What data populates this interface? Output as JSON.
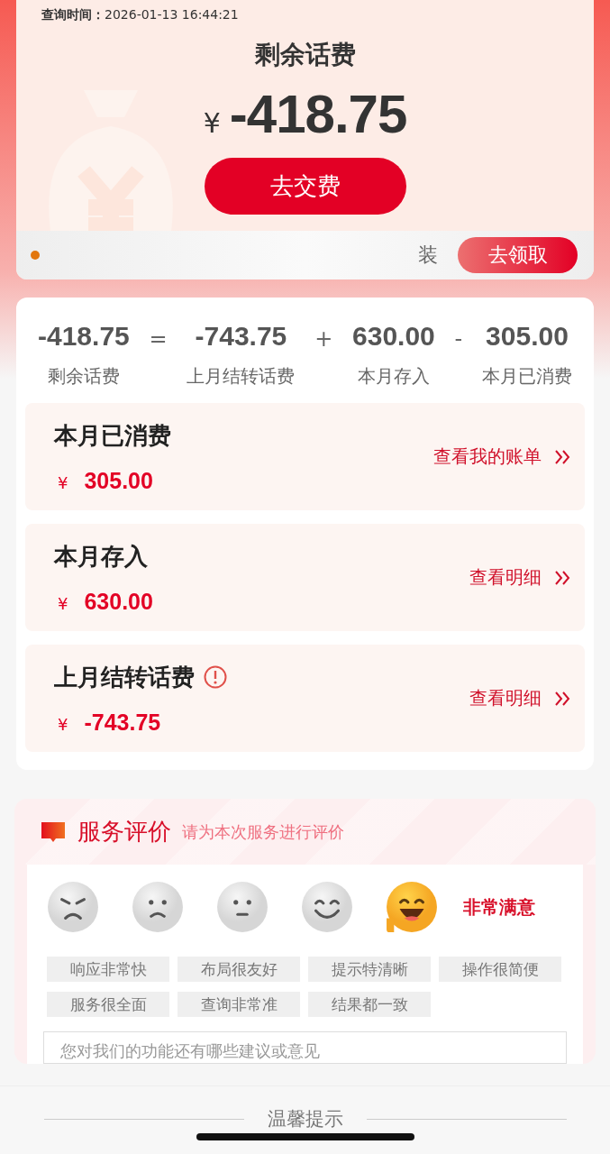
{
  "balance_card": {
    "query_label": "查询时间：",
    "query_time": "2026-01-13 16:44:21",
    "title": "剩余话费",
    "currency": "¥",
    "amount": "-418.75",
    "pay_button": "去交费"
  },
  "banner": {
    "text": "装",
    "button": "去领取"
  },
  "equation": [
    {
      "kind": "term",
      "value": "-418.75",
      "label": "剩余话费"
    },
    {
      "kind": "operator",
      "symbol": "="
    },
    {
      "kind": "term",
      "value": "-743.75",
      "label": "上月结转话费"
    },
    {
      "kind": "operator",
      "symbol": "+"
    },
    {
      "kind": "term",
      "value": "630.00",
      "label": "本月存入"
    },
    {
      "kind": "operator",
      "symbol": "-"
    },
    {
      "kind": "term",
      "value": "305.00",
      "label": "本月已消费"
    }
  ],
  "details": [
    {
      "title": "本月已消费",
      "info": false,
      "currency": "¥",
      "amount": "305.00",
      "link": "查看我的账单"
    },
    {
      "title": "本月存入",
      "info": false,
      "currency": "¥",
      "amount": "630.00",
      "link": "查看明细"
    },
    {
      "title": "上月结转话费",
      "info": true,
      "currency": "¥",
      "amount": "-743.75",
      "link": "查看明细"
    }
  ],
  "rating": {
    "title": "服务评价",
    "subtitle": "请为本次服务进行评价",
    "faces": [
      {
        "kind": "angry",
        "selected": false
      },
      {
        "kind": "sad",
        "selected": false
      },
      {
        "kind": "neutral",
        "selected": false
      },
      {
        "kind": "smile",
        "selected": false
      },
      {
        "kind": "laugh",
        "selected": true
      }
    ],
    "selected_label": "非常满意",
    "tags": [
      "响应非常快",
      "布局很友好",
      "提示特清晰",
      "操作很简便",
      "服务很全面",
      "查询非常准",
      "结果都一致"
    ],
    "feedback": {
      "placeholder": "您对我们的功能还有哪些建议或意见"
    }
  },
  "footer": {
    "title": "温馨提示"
  }
}
